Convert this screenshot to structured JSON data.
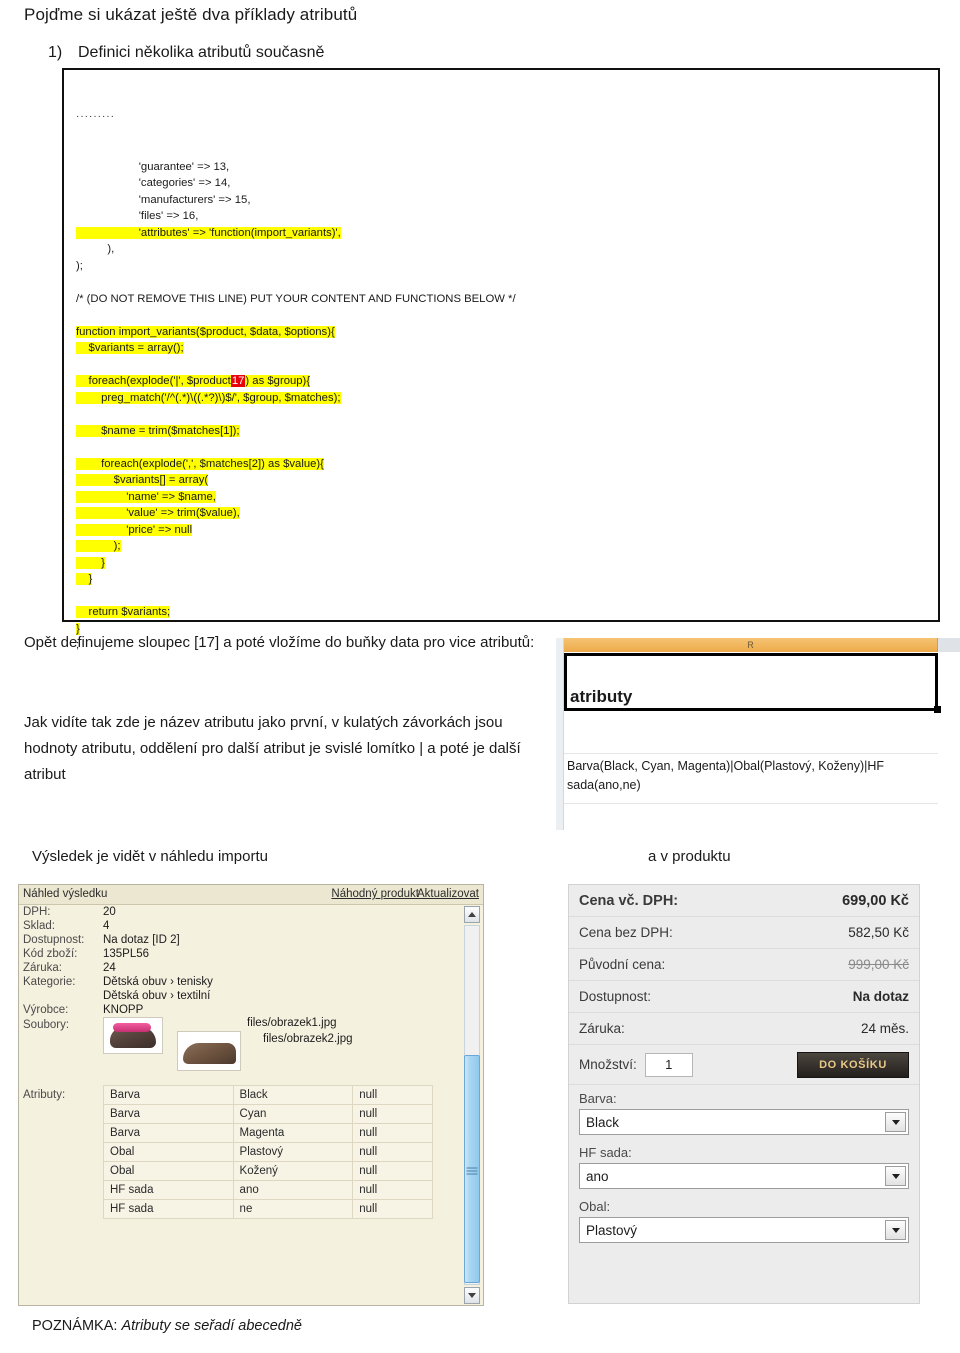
{
  "document": {
    "title": "Pojďme si ukázat ještě dva příklady atributů",
    "section": {
      "number": "1)",
      "text": "Definici několika atributů současně"
    },
    "para1": "Opět definujeme sloupec [17] a poté vložíme do buňky data pro vice atributů:",
    "para2": "Jak vidíte tak zde je název atributu jako první, v kulatých závorkách jsou hodnoty atributu, oddělení pro další atribut je svislé lomítko | a poté je další atribut",
    "caption_left": "Výsledek je vidět v náhledu importu",
    "caption_right": "a v produktu",
    "note_prefix": "POZNÁMKA: ",
    "note_text": "Atributy se seřadí abecedně"
  },
  "code": {
    "ellipsis": "·········",
    "lines": [
      {
        "text": "                    'guarantee' => 13,",
        "hl": false
      },
      {
        "text": "                    'categories' => 14,",
        "hl": false
      },
      {
        "text": "                    'manufacturers' => 15,",
        "hl": false
      },
      {
        "text": "                    'files' => 16,",
        "hl": false
      },
      {
        "text": "                    'attributes' => 'function(import_variants)',",
        "hl": true
      },
      {
        "text": "          ),",
        "hl": false
      },
      {
        "text": ");",
        "hl": false
      },
      {
        "text": "",
        "hl": false
      },
      {
        "text": "/* (DO NOT REMOVE THIS LINE) PUT YOUR CONTENT AND FUNCTIONS BELOW */",
        "hl": false
      },
      {
        "text": "",
        "hl": false
      },
      {
        "text": "function import_variants($product, $data, $options){",
        "hl": true
      },
      {
        "text": "    $variants = array();",
        "hl": true
      },
      {
        "text": "",
        "hl": false
      },
      {
        "text": "    foreach(explode('|', $product",
        "hl": true,
        "red": "17",
        "after": ") as $group){"
      },
      {
        "text": "        preg_match('/^(.*)\\((.*?)\\)$/', $group, $matches);",
        "hl": true
      },
      {
        "text": "",
        "hl": false
      },
      {
        "text": "        $name = trim($matches[1]);",
        "hl": true
      },
      {
        "text": "",
        "hl": false
      },
      {
        "text": "        foreach(explode(',', $matches[2]) as $value){",
        "hl": true
      },
      {
        "text": "            $variants[] = array(",
        "hl": true
      },
      {
        "text": "                'name' => $name,",
        "hl": true
      },
      {
        "text": "                'value' => trim($value),",
        "hl": true
      },
      {
        "text": "                'price' => null",
        "hl": true
      },
      {
        "text": "            );",
        "hl": true
      },
      {
        "text": "        }",
        "hl": true
      },
      {
        "text": "    }",
        "hl": true
      },
      {
        "text": "",
        "hl": false
      },
      {
        "text": "    return $variants;",
        "hl": true
      },
      {
        "text": "}",
        "hl": true
      },
      {
        "text": ";",
        "hl": false
      }
    ]
  },
  "spreadsheet": {
    "column_letter": "R",
    "header_cell": "atributy",
    "data_cell": "Barva(Black, Cyan, Magenta)|Obal(Plastový, Koženy)|HF sada(ano,ne)",
    "header_color": "#eda94a"
  },
  "preview": {
    "title": "Náhled výsledku",
    "link_random": "Náhodný produkt",
    "link_refresh": "Aktualizovat",
    "rows": [
      {
        "label": "DPH:",
        "value": "20"
      },
      {
        "label": "Sklad:",
        "value": "4"
      },
      {
        "label": "Dostupnost:",
        "value": "Na dotaz [ID 2]"
      },
      {
        "label": "Kód zboží:",
        "value": "135PL56"
      },
      {
        "label": "Záruka:",
        "value": "24"
      },
      {
        "label": "Kategorie:",
        "value": "Dětská obuv › tenisky"
      },
      {
        "label": "",
        "value": "Dětská obuv › textilní"
      },
      {
        "label": "Výrobce:",
        "value": "KNOPP"
      }
    ],
    "files_label": "Soubory:",
    "file1": "files/obrazek1.jpg",
    "file2": "files/obrazek2.jpg",
    "attributes_label": "Atributy:",
    "attributes": [
      [
        "Barva",
        "Black",
        "null"
      ],
      [
        "Barva",
        "Cyan",
        "null"
      ],
      [
        "Barva",
        "Magenta",
        "null"
      ],
      [
        "Obal",
        "Plastový",
        "null"
      ],
      [
        "Obal",
        "Kožený",
        "null"
      ],
      [
        "HF sada",
        "ano",
        "null"
      ],
      [
        "HF sada",
        "ne",
        "null"
      ]
    ]
  },
  "product": {
    "rows": [
      {
        "label": "Cena vč. DPH:",
        "value": "699,00 Kč",
        "style": "strong"
      },
      {
        "label": "Cena bez DPH:",
        "value": "582,50 Kč",
        "style": ""
      },
      {
        "label": "Původní cena:",
        "value": "999,00 Kč",
        "style": "strike"
      },
      {
        "label": "Dostupnost:",
        "value": "Na dotaz",
        "style": "bold-v"
      },
      {
        "label": "Záruka:",
        "value": "24 měs.",
        "style": ""
      }
    ],
    "qty_label": "Množství:",
    "qty_value": "1",
    "cart_button": "DO KOŠÍKU",
    "selects": [
      {
        "label": "Barva:",
        "value": "Black"
      },
      {
        "label": "HF sada:",
        "value": "ano"
      },
      {
        "label": "Obal:",
        "value": "Plastový"
      }
    ]
  }
}
